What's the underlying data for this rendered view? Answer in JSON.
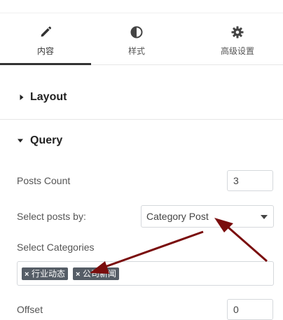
{
  "tabs": [
    {
      "label": "内容",
      "icon": "pencil-icon",
      "active": true
    },
    {
      "label": "样式",
      "icon": "contrast-icon",
      "active": false
    },
    {
      "label": "高级设置",
      "icon": "gear-icon",
      "active": false
    }
  ],
  "sections": {
    "layout": {
      "title": "Layout",
      "expanded": false
    },
    "query": {
      "title": "Query",
      "expanded": true
    }
  },
  "fields": {
    "posts_count": {
      "label": "Posts Count",
      "value": "3"
    },
    "select_posts_by": {
      "label": "Select posts by:",
      "value": "Category Post"
    },
    "select_categories": {
      "label": "Select Categories",
      "tags": [
        "行业动态",
        "公司新闻"
      ]
    },
    "offset": {
      "label": "Offset",
      "value": "0"
    }
  },
  "colors": {
    "accent": "#333333",
    "tag_bg": "#555d66",
    "annotation_arrow": "#7a0d0d",
    "border": "#d5d8dc"
  }
}
